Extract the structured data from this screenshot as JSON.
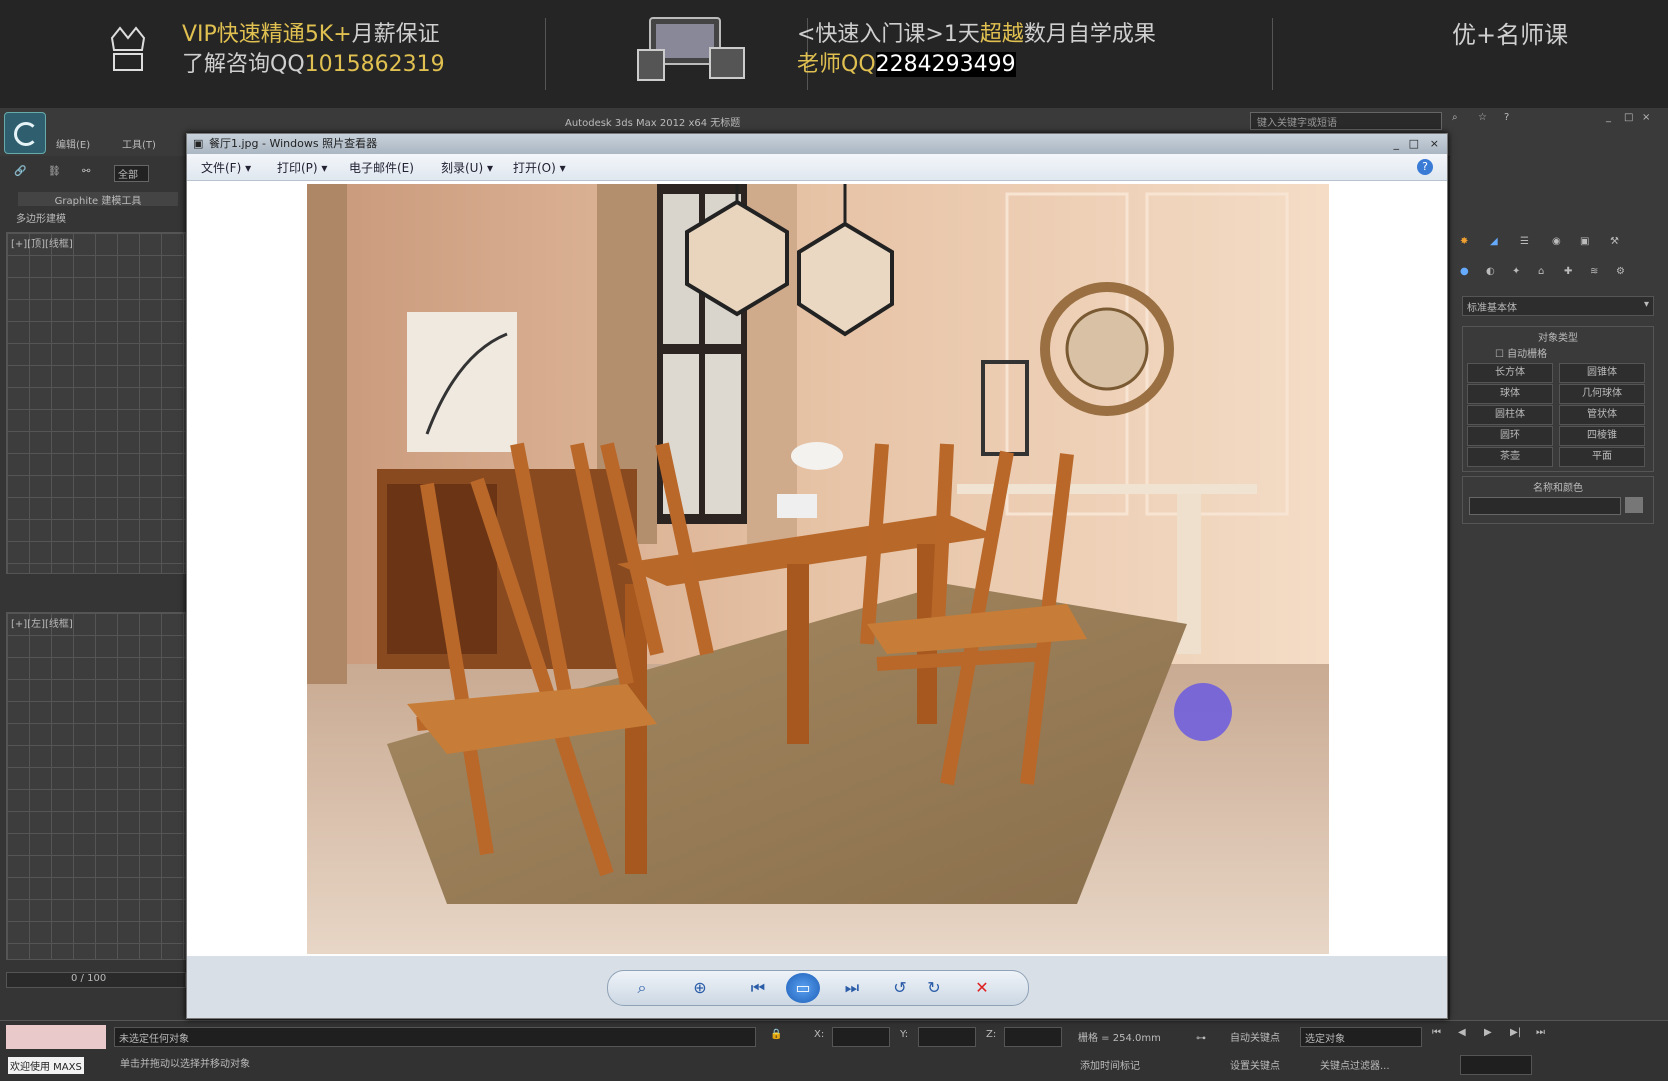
{
  "banner": {
    "line1_a": "VIP快速精通",
    "line1_hl": "5K+",
    "line1_b": "月薪保证",
    "line2_a": "了解咨询QQ",
    "line2_hl": "1015862319",
    "line3_a": "<快速入门课>1天",
    "line3_hl": "超越",
    "line3_b": "数月自学成果",
    "line4_a": "老师QQ",
    "line4_hl": "2284293499",
    "brand": "优+名师课"
  },
  "max": {
    "title": "Autodesk 3ds Max  2012 x64   无标题",
    "search_placeholder": "键入关键字或短语",
    "menu1": "编辑(E)",
    "menu2": "工具(T)",
    "toolbar_label": "全部",
    "graphite": "Graphite 建模工具",
    "poly": "多边形建模",
    "viewport1": "[+][顶][线框]",
    "viewport2": "[+][左][线框]",
    "frame_counter": "0 / 100",
    "dropdown": "标准基本体",
    "rollout_title": "对象类型",
    "autogrid": "自动栅格",
    "buttons": [
      "长方体",
      "圆锥体",
      "球体",
      "几何球体",
      "圆柱体",
      "管状体",
      "圆环",
      "四棱锥",
      "茶壶",
      "平面"
    ],
    "name_color": "名称和颜色",
    "status1": "未选定任何对象",
    "status2": "单击并拖动以选择并移动对象",
    "grid": "栅格 = 254.0mm",
    "autokey": "自动关键点",
    "selected": "选定对象",
    "setkey": "设置关键点",
    "keyfilter": "关键点过滤器...",
    "coord_x": "X:",
    "coord_y": "Y:",
    "coord_z": "Z:",
    "add_time": "添加时间标记",
    "welcome": "欢迎使用 MAXS"
  },
  "viewer": {
    "title": "餐厅1.jpg - Windows 照片查看器",
    "menu": [
      "文件(F) ▾",
      "打印(P) ▾",
      "电子邮件(E)",
      "刻录(U) ▾",
      "打开(O) ▾"
    ],
    "help": "?",
    "window_controls": [
      "_",
      "□",
      "×"
    ]
  },
  "controls": {
    "zoom": "⌕",
    "fit": "⊕",
    "prev": "⏮",
    "play": "▭",
    "next": "⏭",
    "rotl": "↺",
    "rotr": "↻",
    "delete": "✕"
  }
}
